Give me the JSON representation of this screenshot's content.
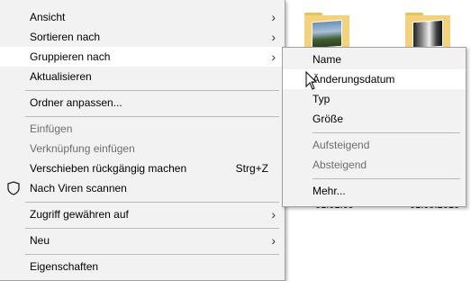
{
  "main_menu": {
    "items": [
      {
        "label": "Ansicht"
      },
      {
        "label": "Sortieren nach"
      },
      {
        "label": "Gruppieren nach"
      },
      {
        "label": "Aktualisieren"
      },
      {
        "label": "Ordner anpassen..."
      },
      {
        "label": "Einfügen"
      },
      {
        "label": "Verknüpfung einfügen"
      },
      {
        "label": "Verschieben rückgängig machen",
        "shortcut": "Strg+Z"
      },
      {
        "label": "Nach Viren scannen",
        "icon": "shield-icon"
      },
      {
        "label": "Zugriff gewähren auf"
      },
      {
        "label": "Neu"
      },
      {
        "label": "Eigenschaften"
      }
    ]
  },
  "sub_menu": {
    "items": [
      {
        "label": "Name"
      },
      {
        "label": "Änderungsdatum"
      },
      {
        "label": "Typ"
      },
      {
        "label": "Größe"
      },
      {
        "label": "Aufsteigend"
      },
      {
        "label": "Absteigend"
      },
      {
        "label": "Mehr..."
      }
    ]
  },
  "desktop": {
    "date_1": "01.01.09",
    "date_2": "01.09.2016"
  },
  "colors": {
    "menu_bg": "#f2f2f2",
    "highlight_bg": "#ffffff",
    "disabled_text": "#6d6d6d",
    "separator": "#b9b9b9"
  }
}
